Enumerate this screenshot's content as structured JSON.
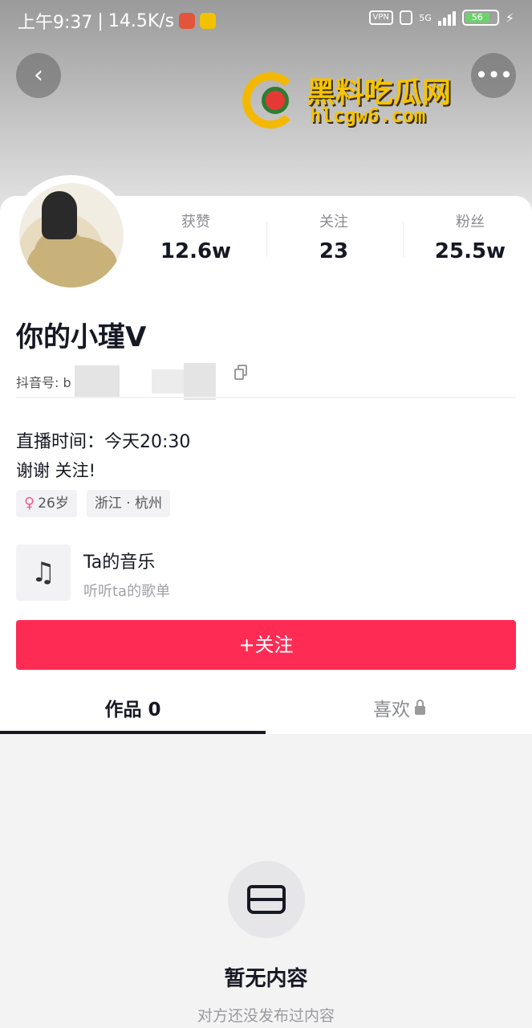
{
  "status_bar": {
    "time": "上午9:37",
    "speed": "14.5K/s",
    "vpn": "VPN",
    "network": "5G",
    "battery": "56"
  },
  "watermark": {
    "title": "黑料吃瓜网",
    "url": "hlcgw6.com"
  },
  "profile": {
    "stats": [
      {
        "label": "获赞",
        "value": "12.6w"
      },
      {
        "label": "关注",
        "value": "23"
      },
      {
        "label": "粉丝",
        "value": "25.5w"
      }
    ],
    "nickname": "你的小瑾V",
    "douyin_id_prefix": "抖音号: b",
    "live_time": "直播时间：今天20:30",
    "bio": "谢谢 关注!",
    "tags": [
      "26岁",
      "浙江 · 杭州"
    ],
    "music": {
      "title": "Ta的音乐",
      "subtitle": "听听ta的歌单"
    },
    "follow_label": "+关注"
  },
  "tabs": [
    {
      "label": "作品 0",
      "active": true
    },
    {
      "label": "喜欢",
      "active": false
    }
  ],
  "empty_state": {
    "title": "暂无内容",
    "subtitle": "对方还没发布过内容"
  },
  "colors": {
    "accent": "#fe2c55",
    "watermark": "#f5c400"
  }
}
